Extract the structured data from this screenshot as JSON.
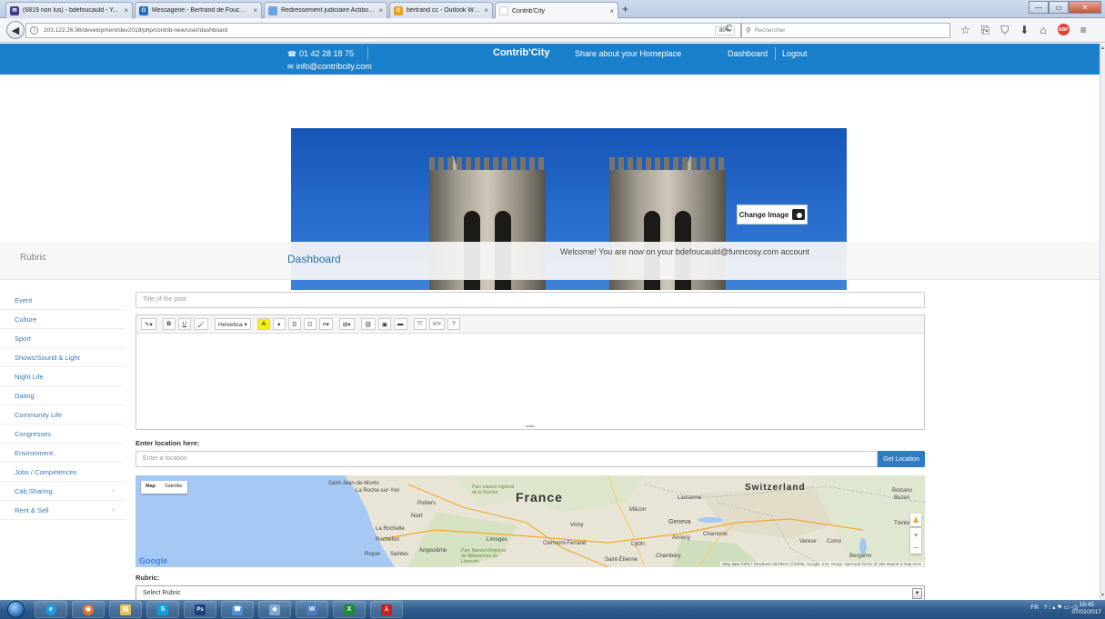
{
  "browser": {
    "tabs": [
      {
        "label": "(6819 non lus) - bdefoucauld - Y...",
        "fav_color": "#3a3f8f",
        "fav_text": "✉"
      },
      {
        "label": "Messagerie - Bertrand de Foucau...",
        "fav_color": "#1f6fc6",
        "fav_text": "O"
      },
      {
        "label": "Redressement judiciaire Actibois à...",
        "fav_color": "#6aa3e0",
        "fav_text": ""
      },
      {
        "label": "bertrand cc - Outlook Web App",
        "fav_color": "#e8a11c",
        "fav_text": "O"
      },
      {
        "label": "Contrib'City",
        "fav_color": "#ffffff",
        "fav_text": ""
      }
    ],
    "tab_close": "×",
    "new_tab": "+",
    "url": "203.122.26.98/development/dev2018/php/contrib-new/user/dashboard",
    "zoom": "80%",
    "search_placeholder": "Rechercher",
    "window_controls": {
      "minimize": "—",
      "maximize": "▭",
      "close": "✕"
    },
    "toolbar_icons": [
      "☆",
      "⎘",
      "⛉",
      "⬇",
      "⌂"
    ],
    "abp_label": "ABP",
    "menu_icon": "≡"
  },
  "header": {
    "phone": "01 42 28 18 75",
    "email": "info@contribcity.com",
    "brand": "Contrib'City",
    "tagline": "Share about your Homeplace",
    "nav_dashboard": "Dashboard",
    "nav_logout": "Logout"
  },
  "banner": {
    "change_image_label": "Change Image"
  },
  "dashboard": {
    "rubric_heading": "Rubric",
    "title": "Dashboard",
    "welcome": "Welcome! You are now on your bdefoucauld@funncosy.com account"
  },
  "sidebar": {
    "items": [
      {
        "label": "Event",
        "chev": ""
      },
      {
        "label": "Culture",
        "chev": ""
      },
      {
        "label": "Sport",
        "chev": ""
      },
      {
        "label": "Shows/Sound & Light",
        "chev": ""
      },
      {
        "label": "Night Life",
        "chev": ""
      },
      {
        "label": "Dating",
        "chev": ""
      },
      {
        "label": "Community Life",
        "chev": ""
      },
      {
        "label": "Congresses",
        "chev": ""
      },
      {
        "label": "Environment",
        "chev": ""
      },
      {
        "label": "Jobs / Competences",
        "chev": ""
      },
      {
        "label": "Cab Sharing",
        "chev": "‹"
      },
      {
        "label": "Rent & Sell",
        "chev": "‹"
      }
    ]
  },
  "form": {
    "title_placeholder": "Title of the post",
    "editor_toolbar": [
      "✎▾",
      "B",
      "U",
      "🖌",
      "Helvetica ▾",
      "A",
      "▾",
      "☰",
      "☷",
      "≡▾",
      "⊞▾",
      "⛓",
      "▣",
      "▬",
      "⤧",
      "</>",
      "?"
    ],
    "location_label": "Enter location here:",
    "location_placeholder": "Enter a location",
    "get_location_button": "Get Location",
    "map": {
      "type_map": "Map",
      "type_satellite": "Satellite",
      "labels": {
        "france": "France",
        "switzerland": "Switzerland",
        "poitiers": "Poitiers",
        "larochelle": "La Rochelle",
        "rochefort": "Rochefort",
        "limoges": "Limoges",
        "vichy": "Vichy",
        "clermont": "Clermont-Ferrand",
        "lyon": "Lyon",
        "geneva": "Geneva",
        "lausanne": "Lausanne",
        "annecy": "Annecy",
        "chambery": "Chambéry",
        "macon": "Mâcon",
        "niort": "Niort",
        "angouleme": "Angoulême",
        "royan": "Royan",
        "saintes": "Saintes",
        "larochesuryon": "La Roche-sur-Yon",
        "saintjean": "Saint-Jean-de-Monts",
        "bergamo": "Bergamo",
        "bolzano": "Bolzano",
        "como": "Como",
        "saintetienne": "Saint-Étienne",
        "chamonix": "Chamonix",
        "trento": "Trento",
        "bozen": "Bozen",
        "varese": "Varese",
        "brenne": "Parc naturel régional de la Brenne",
        "millevaches": "Parc Naturel Régional de Millevaches en Limousin"
      },
      "google": "Google",
      "attribution": "Map data ©2017 GeoBasis-DE/BKG (©2009), Google, Inst. Geogr. Nacional   Terms of Use   Report a map error",
      "zoom_in": "+",
      "zoom_out": "−",
      "pegman": "♟"
    },
    "rubric_label": "Rubric:",
    "rubric_select_value": "Select Rubric"
  },
  "taskbar": {
    "apps": [
      {
        "color": "#1e9be6",
        "text": "e"
      },
      {
        "color": "#e8742a",
        "text": "◉"
      },
      {
        "color": "#e6c15a",
        "text": "▤"
      },
      {
        "color": "#0aa0e0",
        "text": "S"
      },
      {
        "color": "#1c3f7e",
        "text": "Ps"
      },
      {
        "color": "#4d90d9",
        "text": "☎"
      },
      {
        "color": "#7fa7d0",
        "text": "◈"
      },
      {
        "color": "#4a7cc4",
        "text": "W"
      },
      {
        "color": "#1f8a3a",
        "text": "X"
      },
      {
        "color": "#c8201b",
        "text": "⅄"
      }
    ],
    "tray": {
      "lang": "FR",
      "icons": "? ⁝ ▴ ⚑ ▭ ◁)"
    },
    "time": "16:45",
    "date": "07/02/2017"
  }
}
